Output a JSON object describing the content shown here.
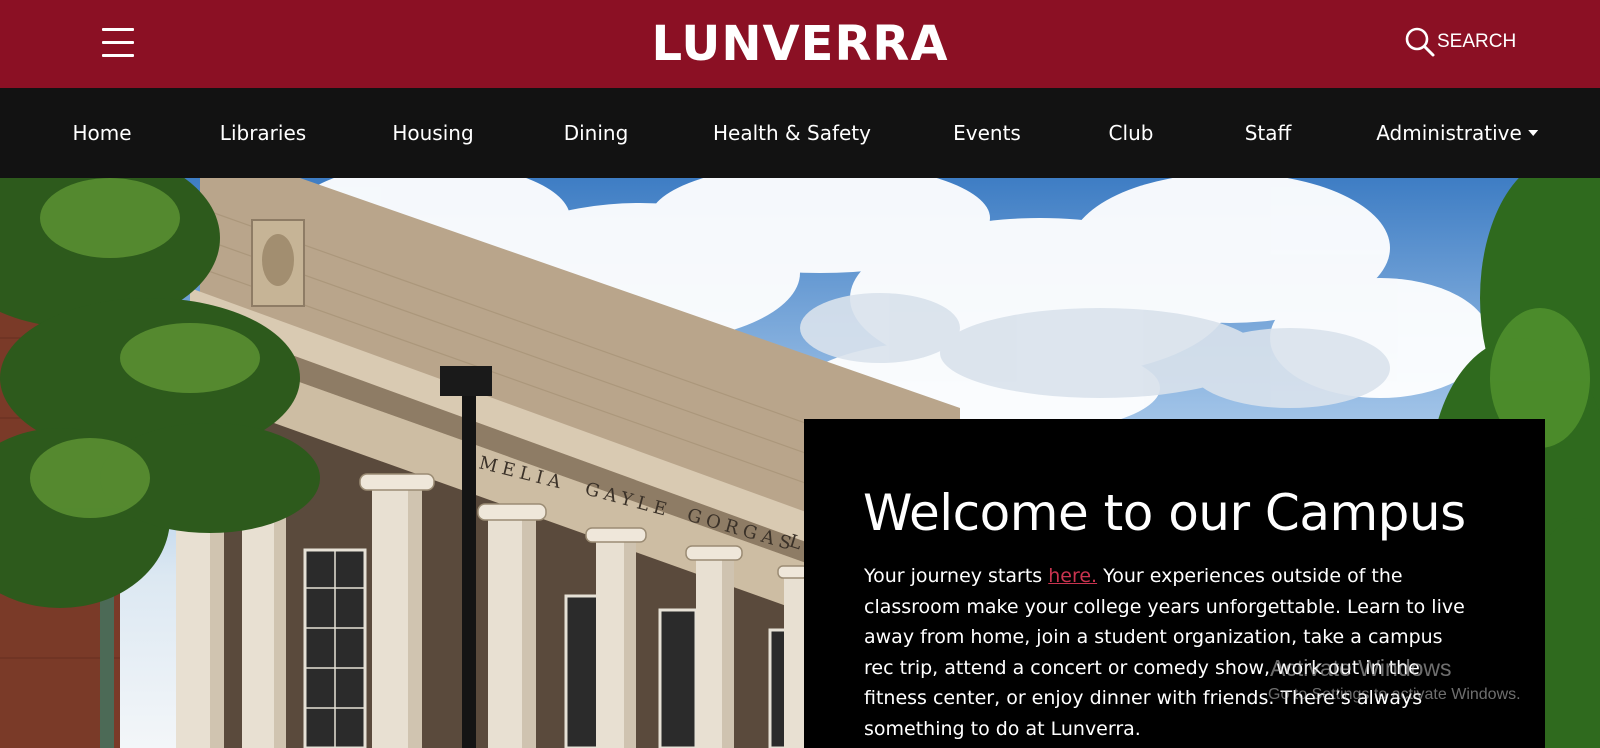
{
  "header": {
    "brand": "LUNVERRA",
    "menu_icon": "hamburger-menu-icon",
    "search_icon": "search-icon",
    "search_label": "SEARCH",
    "background_color": "#8b1024"
  },
  "nav": {
    "items": [
      {
        "label": "Home"
      },
      {
        "label": "Libraries"
      },
      {
        "label": "Housing"
      },
      {
        "label": "Dining"
      },
      {
        "label": "Health & Safety"
      },
      {
        "label": "Events"
      },
      {
        "label": "Club"
      },
      {
        "label": "Staff"
      },
      {
        "label": "Administrative",
        "dropdown": true
      }
    ],
    "background_color": "#121212"
  },
  "hero": {
    "image": "campus-building-photo",
    "building_inscription": "MELIA GAYLE GORGAS L",
    "card": {
      "title": "Welcome to our Campus",
      "body_before_link": "Your journey starts ",
      "link_text": "here.",
      "body_after_link": " Your experiences outside of the classroom make your college years unforgettable. Learn to live away from home, join a student organization, take a campus rec trip, attend a concert or comedy show, work out in the fitness center, or enjoy dinner with friends. There’s always something to do at Lunverra.",
      "link_color": "#c8334f"
    }
  },
  "watermark": {
    "title": "Activate Windows",
    "subtitle": "Go to Settings to activate Windows."
  }
}
